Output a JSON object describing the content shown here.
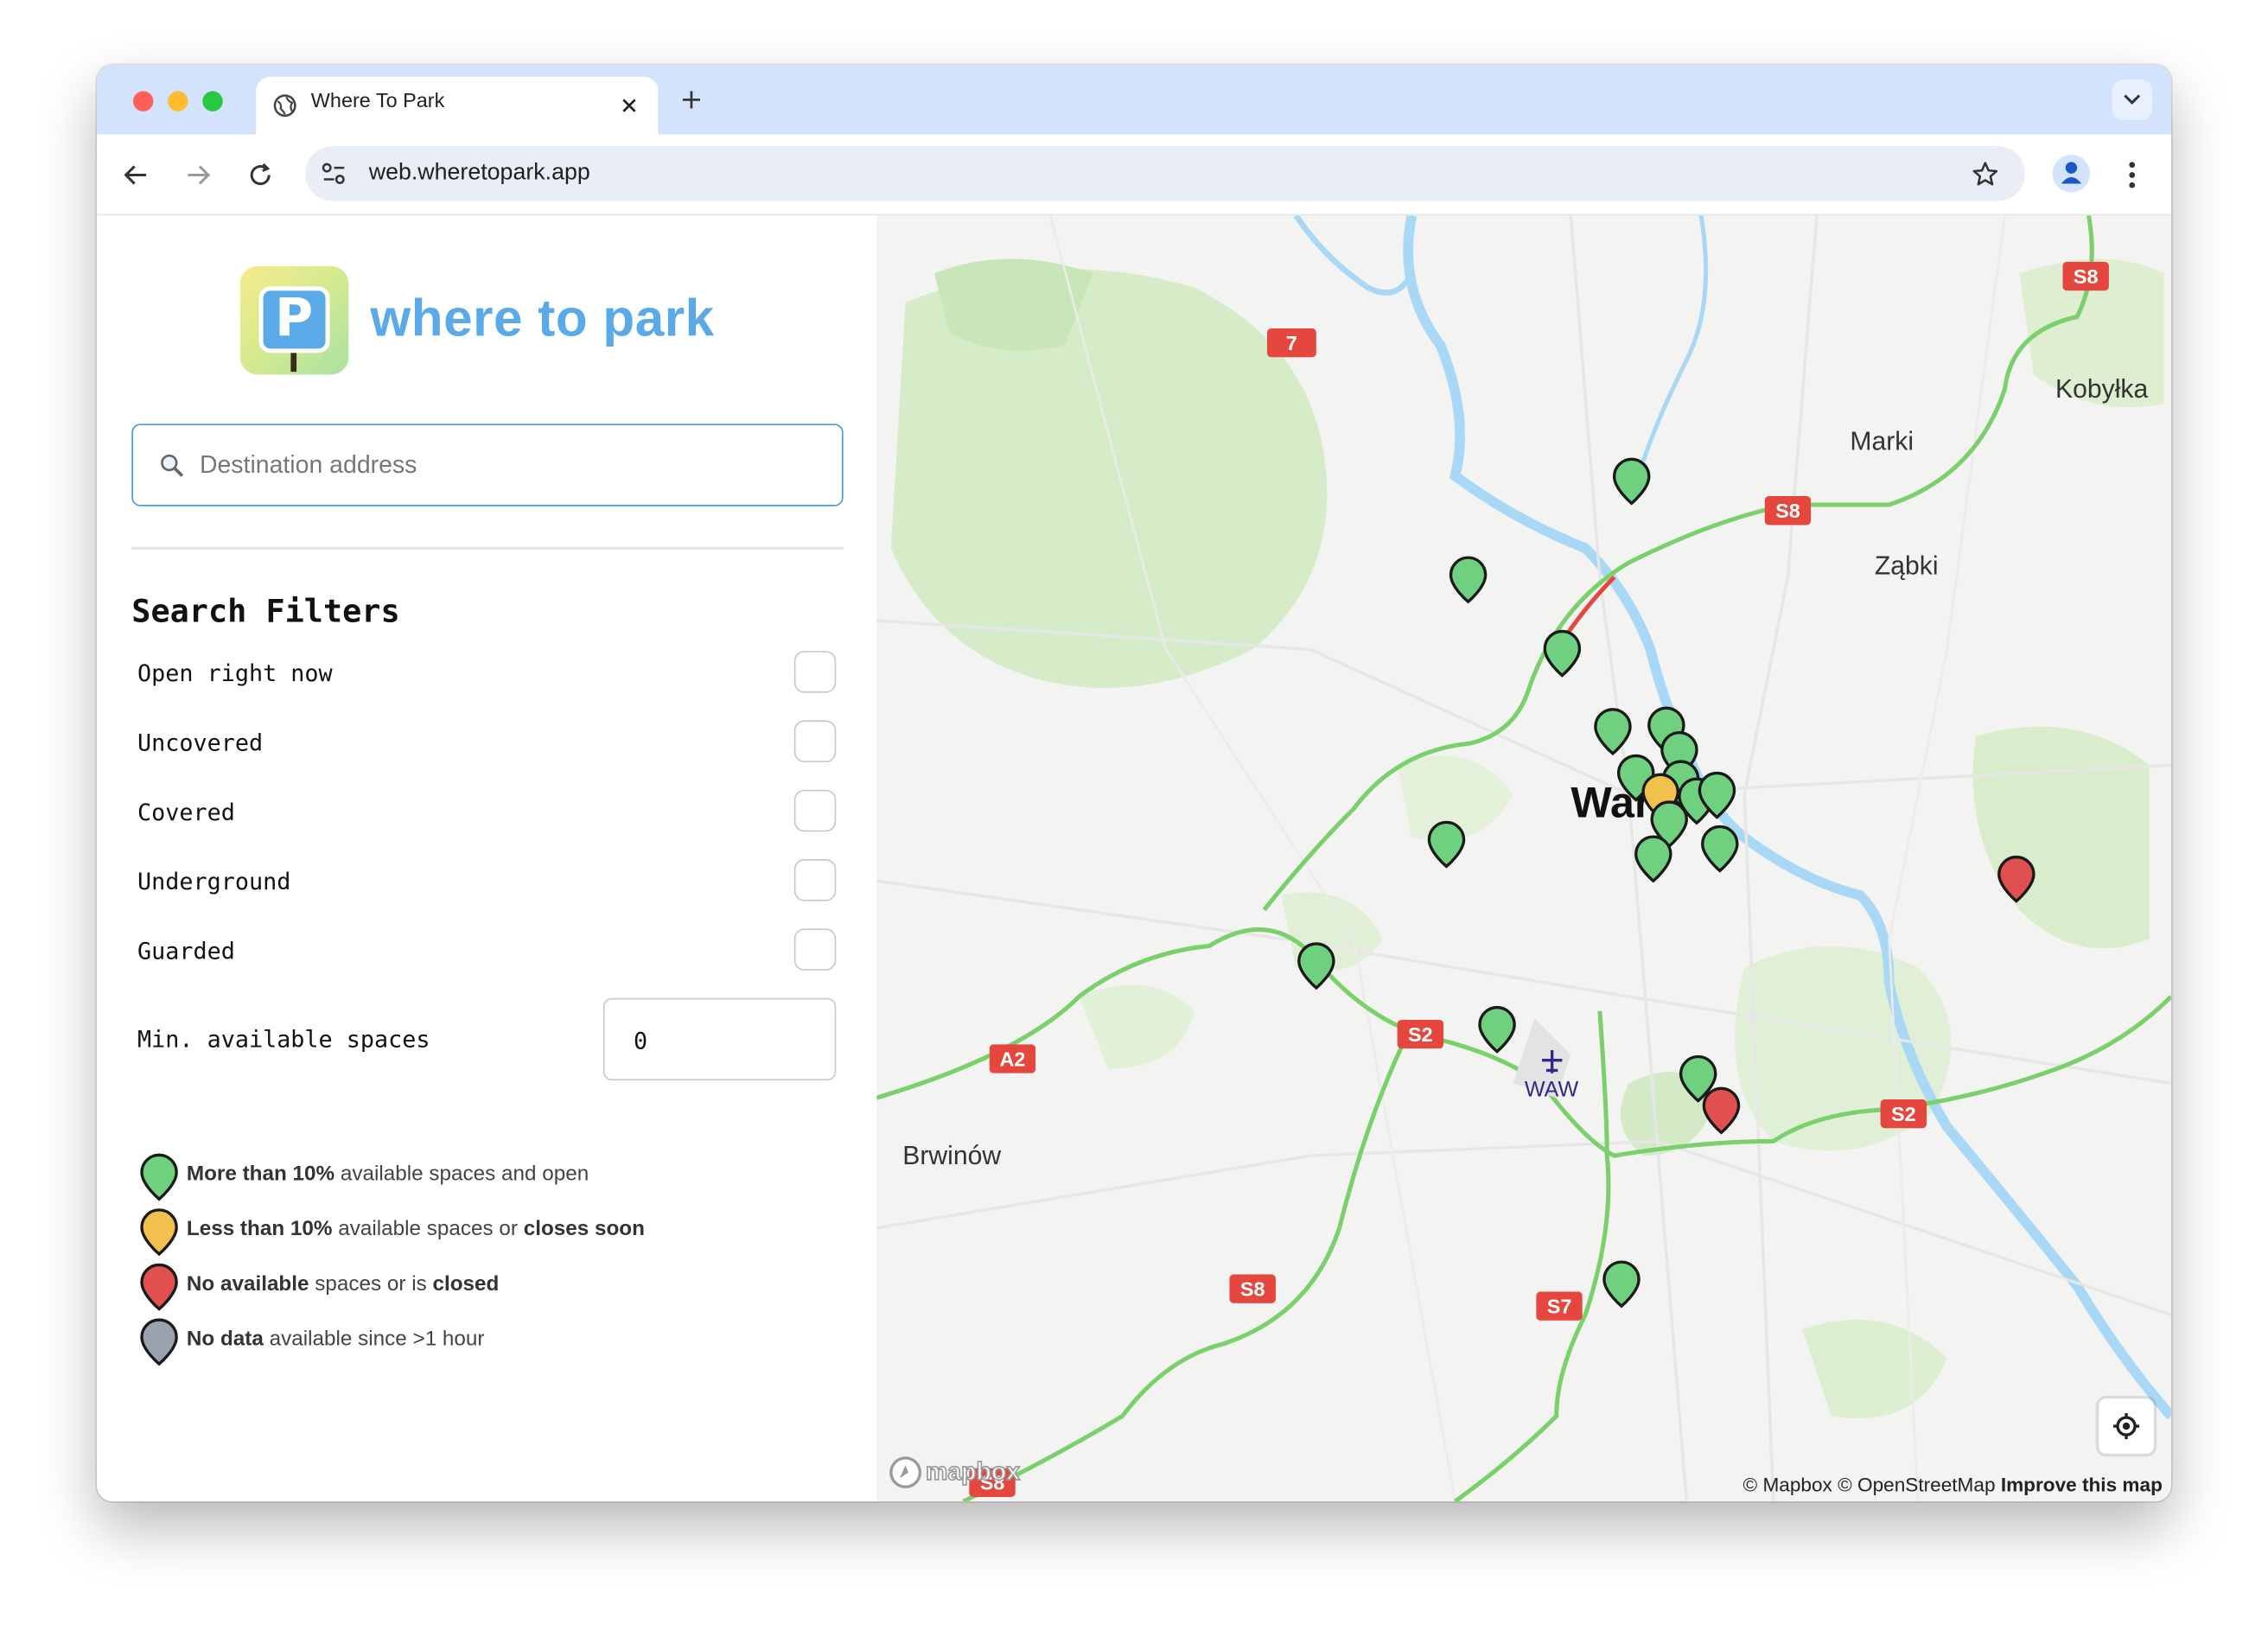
{
  "browser": {
    "tab_title": "Where To Park",
    "url": "web.wheretopark.app"
  },
  "app": {
    "logo_text": "where to park",
    "logo_letter": "P",
    "search_placeholder": "Destination address",
    "filters_title": "Search Filters",
    "filters": [
      {
        "label": "Open right now",
        "checked": false
      },
      {
        "label": "Uncovered",
        "checked": false
      },
      {
        "label": "Covered",
        "checked": false
      },
      {
        "label": "Underground",
        "checked": false
      },
      {
        "label": "Guarded",
        "checked": false
      }
    ],
    "min_spaces_label": "Min. available spaces",
    "min_spaces_value": "0",
    "legend": [
      {
        "bold": "More than 10%",
        "rest": " available spaces and open",
        "color": "#6fd07f"
      },
      {
        "bold": "Less than 10%",
        "rest": " available spaces or ",
        "bold2": "closes soon",
        "color": "#f2c04c"
      },
      {
        "bold": "No available",
        "rest": " spaces or is ",
        "bold2": "closed",
        "color": "#e05050"
      },
      {
        "bold": "No data",
        "rest": " available since >1 hour",
        "color": "#9aa2ad"
      }
    ]
  },
  "map": {
    "places": [
      "Marki",
      "Kobyłka",
      "Ząbki",
      "Brwinów",
      "WAW",
      "Warszawa"
    ],
    "road_labels": [
      "7",
      "S8",
      "S8",
      "A2",
      "S2",
      "S2",
      "S8",
      "S7",
      "S8"
    ],
    "attribution": "© Mapbox © OpenStreetMap",
    "improve_link": "Improve this map",
    "mapbox_logo": "mapbox",
    "colors": {
      "green": "#6fd07f",
      "yellow": "#f2c04c",
      "red": "#e05050",
      "grey": "#9aa2ad",
      "road": "#e5473f",
      "water": "#a8d8f5",
      "park": "#d4edc6"
    }
  }
}
